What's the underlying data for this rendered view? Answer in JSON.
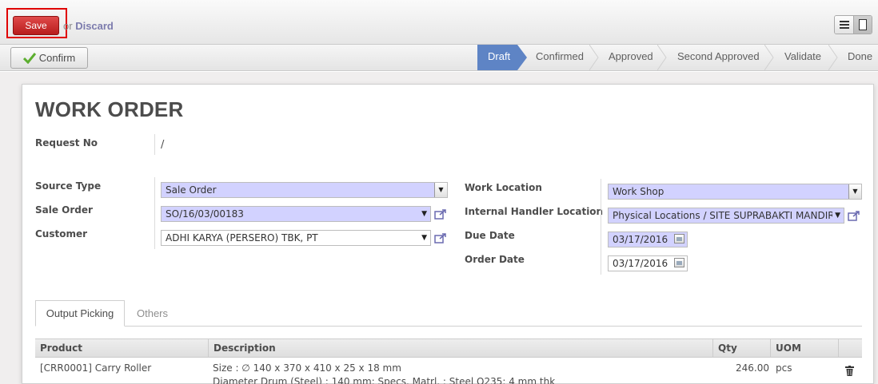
{
  "toolbar": {
    "save_label": "Save",
    "or_label": "or",
    "discard_label": "Discard"
  },
  "statusbar": {
    "confirm_label": "Confirm",
    "stages": [
      "Draft",
      "Confirmed",
      "Approved",
      "Second Approved",
      "Validate",
      "Done"
    ],
    "active_stage": "Draft"
  },
  "form": {
    "title": "WORK ORDER",
    "request_no_label": "Request No",
    "request_no_value": "/",
    "source_type_label": "Source Type",
    "source_type_value": "Sale Order",
    "sale_order_label": "Sale Order",
    "sale_order_value": "SO/16/03/00183",
    "customer_label": "Customer",
    "customer_value": "ADHI KARYA (PERSERO) TBK, PT",
    "work_location_label": "Work Location",
    "work_location_value": "Work Shop",
    "handler_location_label": "Internal Handler Location",
    "handler_location_value": "Physical Locations / SITE SUPRABAKTI MANDIRI",
    "due_date_label": "Due Date",
    "due_date_value": "03/17/2016",
    "order_date_label": "Order Date",
    "order_date_value": "03/17/2016"
  },
  "tabs": {
    "output_picking": "Output Picking",
    "others": "Others"
  },
  "table": {
    "headers": [
      "Product",
      "Description",
      "Qty",
      "UOM"
    ],
    "rows": [
      {
        "product": "[CRR0001] Carry Roller",
        "description_line1": "Size : ∅ 140 x 370 x 410 x 25 x 18 mm",
        "description_line2": "Diameter Drum (Steel) : 140 mm; Specs. Matrl. : Steel Q235; 4 mm thk",
        "qty": "246.00",
        "uom": "pcs"
      }
    ]
  },
  "colors": {
    "save_button": "#c62828",
    "active_stage": "#5e84c5",
    "required_field": "#d2d2ff"
  }
}
